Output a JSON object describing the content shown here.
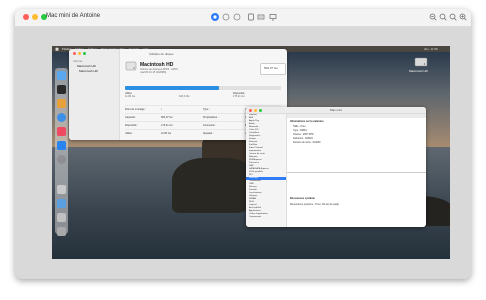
{
  "window": {
    "title": "Mac mini de Antoine"
  },
  "remote_menubar": {
    "items": [
      "Finder",
      "Fichier",
      "Édition",
      "Présentation",
      "Aller",
      "Fenêtre",
      "Aide"
    ],
    "clock": "dim. 11:56"
  },
  "desktop": {
    "hd_label": "Macintosh HD"
  },
  "disk_utility": {
    "window_title": "Utilitaire de disque",
    "sidebar_header": "Interne",
    "sidebar_items": [
      "Macintosh HD",
      "Macintosh HD"
    ],
    "disk_name": "Macintosh HD",
    "disk_subtitle": "Volume de données APFS · APFS",
    "disk_subtitle2": "macOS 10.15 (19A583)",
    "capacity_label": "500,07 Go",
    "usage_fraction": 0.6,
    "used_label": "Utilisé",
    "free_label": "Disponible",
    "used_value": "11,95 Go",
    "other_value": "323,4 Mo",
    "free_value": "175,41 Go",
    "rows": [
      [
        "Point de montage :",
        "/",
        "Type :",
        "Volume de données APFS"
      ],
      [
        "Capacité :",
        "500,07 Go",
        "Propriétaires :",
        "Activé"
      ],
      [
        "Disponible :",
        "175,41 Go",
        "Connexion :",
        "PCI-Express"
      ],
      [
        "Utilisé :",
        "11,95 Go",
        "Appareil :",
        "disk1s1"
      ]
    ]
  },
  "system_info": {
    "window_title": "Mac mini",
    "sidebar": [
      "Matériel",
      "ATA",
      "Apple Pay",
      "Audio",
      "Bluetooth",
      "Carte PCI",
      "Contrôleur",
      "Diagnostics",
      "Disque",
      "Ethernet",
      "FireWire",
      "Fibre Channel",
      "Imprimantes",
      "Lecteur de carte",
      "Mémoire",
      "NVMExpress",
      "Puissance",
      "SAS",
      "SATA/SATA Express",
      "SCSI parallèle",
      "SPI",
      "Stockage",
      "Thunderbolt",
      "USB",
      "Réseau",
      "Firewall",
      "Localisations",
      "Volumes",
      "WWAN",
      "Wi-Fi",
      "Logiciel",
      "Accessibilité",
      "Applications",
      "Cadre d'application",
      "Composants"
    ],
    "selected_index": 21,
    "section_title": "Informations sur la mémoire",
    "section_lines": [
      "Taille : 8 Go",
      "Type : DDR4",
      "Vitesse : 2667 MHz",
      "Fabricant : 0x802C",
      "Numéro de série : 0x0000"
    ],
    "bottom_title": "Ressources système",
    "bottom_line": "Ressources système : 8 Go, 64 Go de swap"
  }
}
